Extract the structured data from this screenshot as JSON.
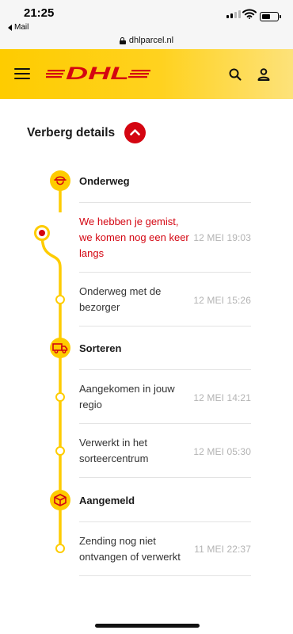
{
  "status_bar": {
    "time": "21:25",
    "back_app": "Mail"
  },
  "browser": {
    "url": "dhlparcel.nl"
  },
  "header": {
    "logo_text": "DHL",
    "icons": [
      "menu-icon",
      "search-icon",
      "user-icon"
    ]
  },
  "details_toggle": {
    "label": "Verberg details"
  },
  "timeline": {
    "phases": [
      {
        "label": "Onderweg",
        "icon": "courier-icon",
        "events": [
          {
            "text": "We hebben je gemist, we komen nog een keer langs",
            "date": "12 MEI 19:03",
            "status": "alert"
          },
          {
            "text": "Onderweg met de bezorger",
            "date": "12 MEI 15:26",
            "status": "normal"
          }
        ]
      },
      {
        "label": "Sorteren",
        "icon": "truck-icon",
        "events": [
          {
            "text": "Aangekomen in jouw regio",
            "date": "12 MEI 14:21",
            "status": "normal"
          },
          {
            "text": "Verwerkt in het sorteercentrum",
            "date": "12 MEI 05:30",
            "status": "normal"
          }
        ]
      },
      {
        "label": "Aangemeld",
        "icon": "package-icon",
        "events": [
          {
            "text": "Zending nog niet ontvangen of verwerkt",
            "date": "11 MEI 22:37",
            "status": "normal"
          }
        ]
      }
    ]
  },
  "colors": {
    "dhl_yellow": "#fecc00",
    "dhl_red": "#d40511",
    "date_grey": "#b3b3b3",
    "separator": "#e3e3e3"
  }
}
